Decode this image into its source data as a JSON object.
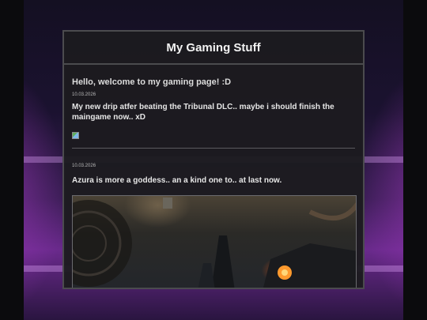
{
  "page": {
    "title": "My Gaming Stuff",
    "welcome": "Hello, welcome to my gaming page! :D"
  },
  "posts": [
    {
      "date": "10.03.2026",
      "text": "My new drip atfer beating the Tribunal DLC.. maybe i should finish the maingame now.. xD",
      "image": "broken-image-icon"
    },
    {
      "date": "10.03.2026",
      "text": "Azura is more a goddess.. an a kind one to.. at last now.",
      "image": "game-screenshot"
    }
  ],
  "colors": {
    "panel_bg": "#1c1b1f",
    "panel_border": "#4b4b4e",
    "title_text": "#f2f2f2",
    "accent_glow": "#6a2a8c"
  }
}
